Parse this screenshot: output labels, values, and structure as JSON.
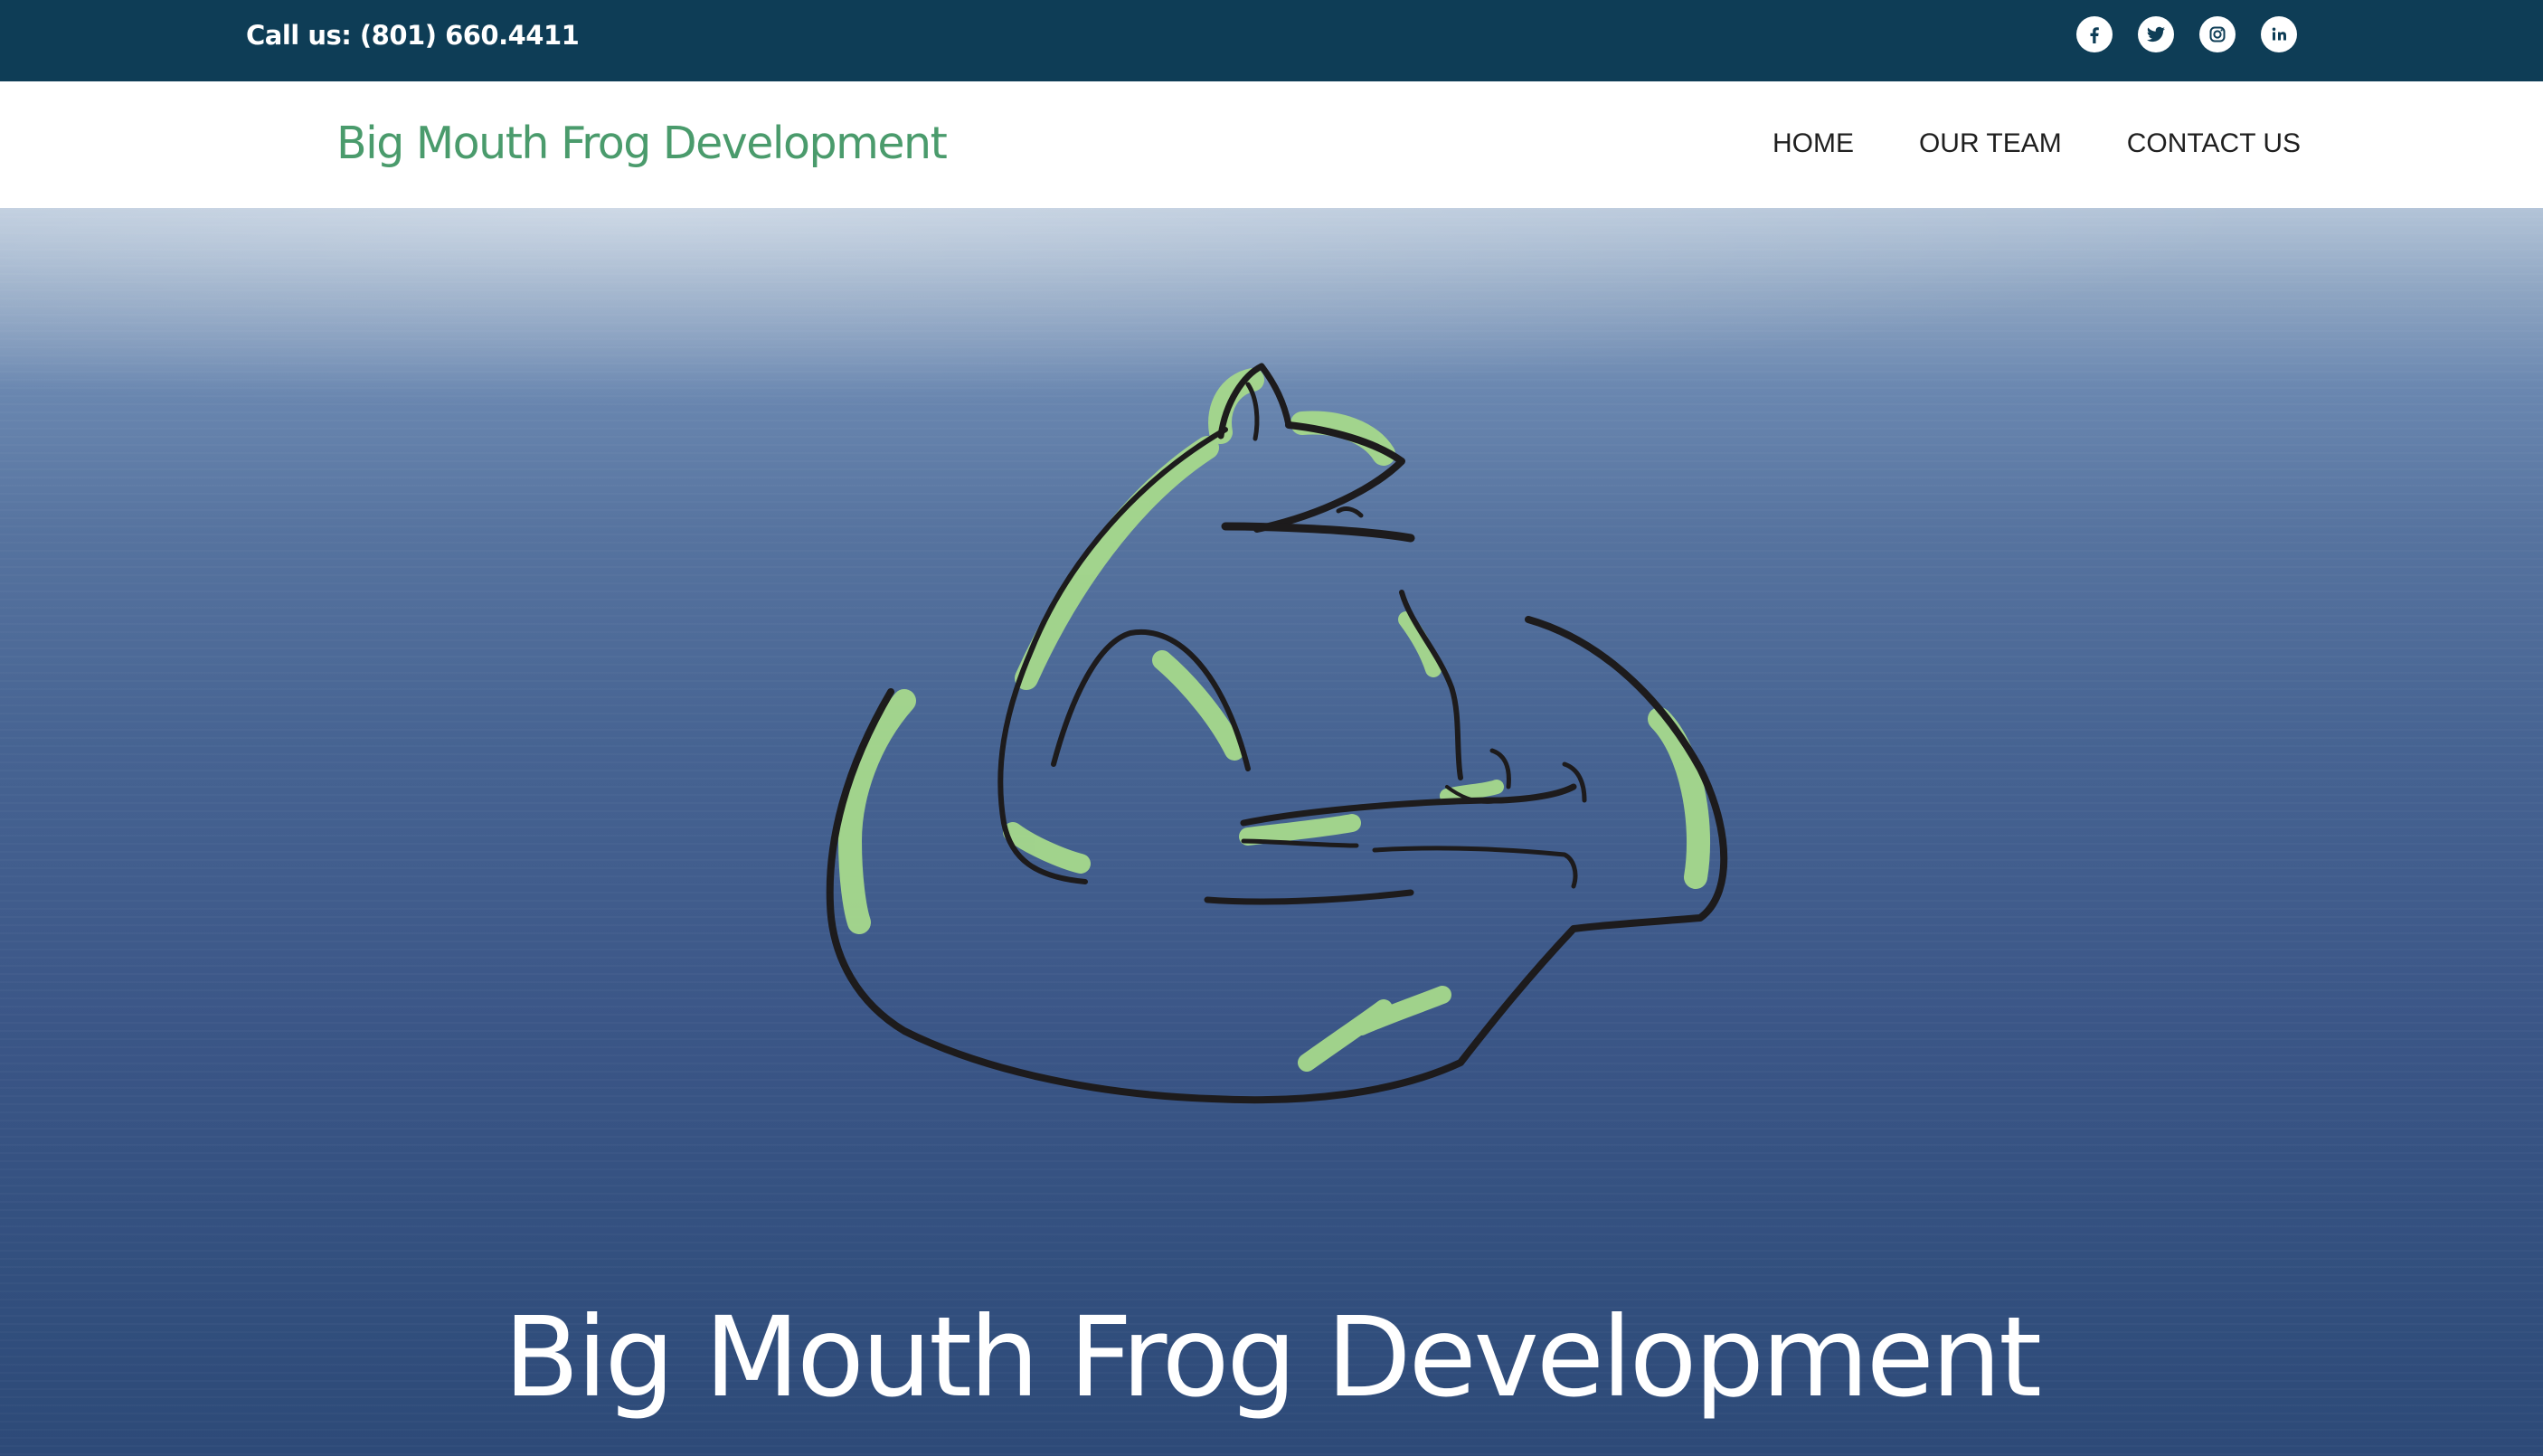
{
  "topbar": {
    "phone": "Call us: (801) 660.4411",
    "social": [
      {
        "icon": "facebook-icon"
      },
      {
        "icon": "twitter-icon"
      },
      {
        "icon": "instagram-icon"
      },
      {
        "icon": "linkedin-icon"
      }
    ]
  },
  "navbar": {
    "brand": "Big Mouth Frog Development",
    "menu": {
      "home": "HOME",
      "our_team": "OUR TEAM",
      "contact_us": "CONTACT US"
    }
  },
  "hero": {
    "title": "Big Mouth Frog Development",
    "logo_icon": "frog-logo-icon"
  },
  "colors": {
    "topbar": "#0e3d56",
    "brand_green": "#4a9b6c",
    "frog_green": "#a6d98c",
    "hero_blue": "#3b5687"
  }
}
